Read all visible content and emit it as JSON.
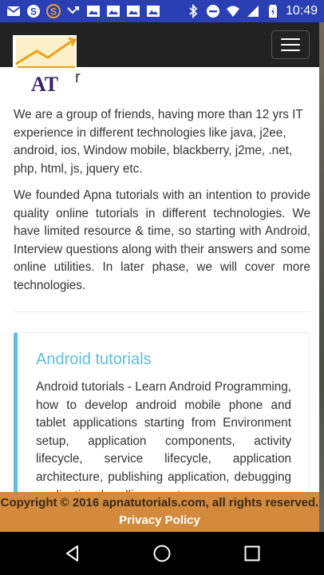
{
  "status_bar": {
    "time": "10:49",
    "left_icons": [
      "email-icon",
      "skype-icon",
      "s-icon",
      "missed-call-icon",
      "gallery-icon",
      "gallery-icon",
      "gallery-icon",
      "image-icon"
    ],
    "right_icons": [
      "bluetooth-icon",
      "do-not-disturb-icon",
      "wifi-icon",
      "signal-icon",
      "battery-icon"
    ]
  },
  "navbar": {
    "logo_text": "AT"
  },
  "content": {
    "heading_partial": "r",
    "paragraph1": "We are a group of friends, having more than 12 yrs IT experience in different technologies like java, j2ee, android, ios, Window mobile, blackberry, j2me, .net, php, html, js, jquery etc.",
    "paragraph2": "We founded Apna tutorials with an intention to provide quality online tutorials in different technologies. We have limited resource & time, so starting with Android, Interview questions along with their answers and some online utilities. In later phase, we will cover more technologies.",
    "card": {
      "title": "Android tutorials",
      "text": "Android tutorials - Learn Android Programming, how to develop android mobile phone and tablet applications starting from Environment setup, application components, activity lifecycle, service lifecycle, application architecture, publishing application, debugging application, handling events..."
    }
  },
  "footer": {
    "copyright": "Copyright © 2016 apnatutorials.com, all rights reserved.",
    "privacy_link": "Privacy Policy"
  },
  "colors": {
    "status_bar": "#2b3fb5",
    "navbar": "#222222",
    "footer": "#d48a3c",
    "card_accent": "#5bc0de"
  }
}
